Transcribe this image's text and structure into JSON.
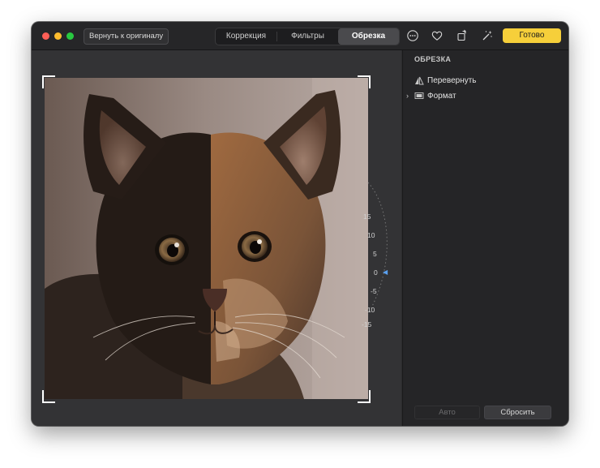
{
  "toolbar": {
    "revert_label": "Вернуть к оригиналу",
    "tabs": [
      {
        "label": "Коррекция",
        "selected": false
      },
      {
        "label": "Фильтры",
        "selected": false
      },
      {
        "label": "Обрезка",
        "selected": true
      }
    ],
    "done_label": "Готово",
    "icons": [
      "more-icon",
      "heart-icon",
      "rotate-icon",
      "magic-wand-icon"
    ]
  },
  "crop": {
    "dial_labels": [
      "15",
      "10",
      "5",
      "0",
      "-5",
      "-10",
      "-15"
    ]
  },
  "sidebar": {
    "title": "ОБРЕЗКА",
    "flip_label": "Перевернуть",
    "format_label": "Формат",
    "auto_label": "Авто",
    "reset_label": "Сбросить"
  },
  "colors": {
    "accent": "#f6cf3a",
    "window_bg": "#2b2b2d",
    "sidebar_bg": "#252527",
    "dial_indicator": "#5aa0f0"
  }
}
